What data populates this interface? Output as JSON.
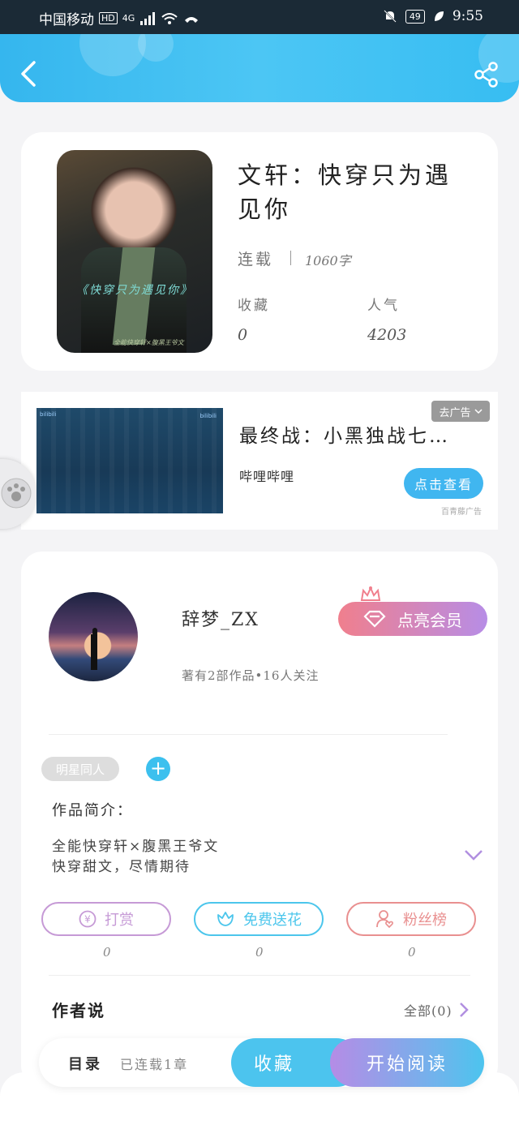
{
  "status_bar": {
    "carrier": "中国移动",
    "hd": "HD",
    "network": "4G",
    "battery": "49",
    "time": "9:55"
  },
  "book": {
    "title": "文轩：快穿只为遇见你",
    "status": "连载",
    "word_count": "1060字",
    "favorites_label": "收藏",
    "favorites_value": "0",
    "popularity_label": "人气",
    "popularity_value": "4203",
    "cover_text": "《快穿只为遇见你》",
    "cover_subtext": "全能快穿轩×腹黑王爷文"
  },
  "ad": {
    "close_label": "去广告",
    "title": "最终战：小黑独战七…",
    "source": "哔哩哔哩",
    "cta": "点击查看",
    "provider": "百青藤广告",
    "logo_left": "bilibili",
    "logo_right": "bilibili"
  },
  "author": {
    "name": "辞梦_ZX",
    "stats": "著有2部作品•16人关注",
    "vip_button": "点亮会员"
  },
  "work": {
    "tag": "明星同人",
    "intro_label": "作品简介：",
    "intro_line1": "全能快穿轩×腹黑王爷文",
    "intro_line2": "快穿甜文，尽情期待"
  },
  "actions": [
    {
      "label": "打赏",
      "count": "0",
      "color": "#c69ad6"
    },
    {
      "label": "免费送花",
      "count": "0",
      "color": "#4cc6ec"
    },
    {
      "label": "粉丝榜",
      "count": "0",
      "color": "#e99090"
    }
  ],
  "author_says": {
    "label": "作者说",
    "all_label": "全部(0)"
  },
  "bottom": {
    "toc_label": "目录",
    "chapters": "已连载1章",
    "collect": "收藏",
    "read": "开始阅读"
  },
  "colors": {
    "accent": "#3cc0ee",
    "vip_gradient_start": "#f07f8d",
    "vip_gradient_end": "#b78de6"
  }
}
